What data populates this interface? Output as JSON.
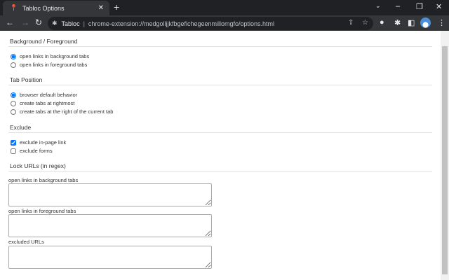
{
  "browser": {
    "tab_title": "Tabloc Options",
    "site_label": "Tabloc",
    "url": "chrome-extension://medgolljjkfbgefichegeenmillomgfo/options.html"
  },
  "sections": {
    "bg_fg": {
      "title": "Background / Foreground",
      "options": [
        {
          "label": "open links in background tabs",
          "checked": true
        },
        {
          "label": "open links in foreground tabs",
          "checked": false
        }
      ]
    },
    "tab_position": {
      "title": "Tab Position",
      "options": [
        {
          "label": "browser default behavior",
          "checked": true
        },
        {
          "label": "create tabs at rightmost",
          "checked": false
        },
        {
          "label": "create tabs at the right of the current tab",
          "checked": false
        }
      ]
    },
    "exclude": {
      "title": "Exclude",
      "options": [
        {
          "label": "exclude in-page link",
          "checked": true
        },
        {
          "label": "exclude forms",
          "checked": false
        }
      ]
    },
    "lock": {
      "title": "Lock URLs (in regex)",
      "fields": [
        {
          "label": "open links in background tabs",
          "value": ""
        },
        {
          "label": "open links in foreground tabs",
          "value": ""
        },
        {
          "label": "excluded URLs",
          "value": ""
        }
      ]
    }
  },
  "colors": {
    "accent": "#1a73e8"
  }
}
